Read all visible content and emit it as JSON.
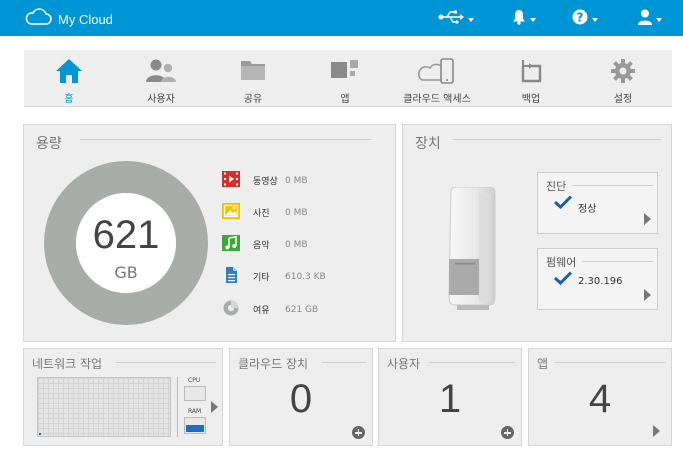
{
  "header": {
    "brand": "My Cloud",
    "icons": [
      "usb-icon",
      "bell-icon",
      "help-icon",
      "user-icon"
    ]
  },
  "nav": {
    "items": [
      {
        "label": "홈",
        "icon": "home-icon",
        "active": true
      },
      {
        "label": "사용자",
        "icon": "users-icon"
      },
      {
        "label": "공유",
        "icon": "folder-icon"
      },
      {
        "label": "앱",
        "icon": "apps-icon"
      },
      {
        "label": "클라우드 액세스",
        "icon": "cloud-access-icon"
      },
      {
        "label": "백업",
        "icon": "backup-icon"
      },
      {
        "label": "설정",
        "icon": "gear-icon"
      }
    ]
  },
  "capacity": {
    "title": "용량",
    "total_value": "621",
    "total_unit": "GB",
    "used_fraction": 0.0,
    "items": [
      {
        "name": "동영상",
        "value": "0 MB",
        "color": "#d0312d",
        "icon": "video-icon"
      },
      {
        "name": "사진",
        "value": "0 MB",
        "color": "#f2c200",
        "icon": "photo-icon"
      },
      {
        "name": "음악",
        "value": "0 MB",
        "color": "#3aaa35",
        "icon": "music-icon"
      },
      {
        "name": "기타",
        "value": "610.3 KB",
        "color": "#2f7dc4",
        "icon": "document-icon"
      },
      {
        "name": "여유",
        "value": "621 GB",
        "color": "#a9ada9",
        "icon": "pie-icon"
      }
    ]
  },
  "device": {
    "title": "장치",
    "diagnostics": {
      "title": "진단",
      "value": "정상"
    },
    "firmware": {
      "title": "펌웨어",
      "value": "2.30.196"
    }
  },
  "network": {
    "title": "네트워크 작업",
    "cpu_label": "CPU",
    "ram_label": "RAM"
  },
  "cloud_devices": {
    "title": "클라우드 장치",
    "count": "0"
  },
  "users": {
    "title": "사용자",
    "count": "1"
  },
  "apps": {
    "title": "앱",
    "count": "4"
  },
  "colors": {
    "accent": "#0096d6",
    "panel": "#eeeeee"
  }
}
